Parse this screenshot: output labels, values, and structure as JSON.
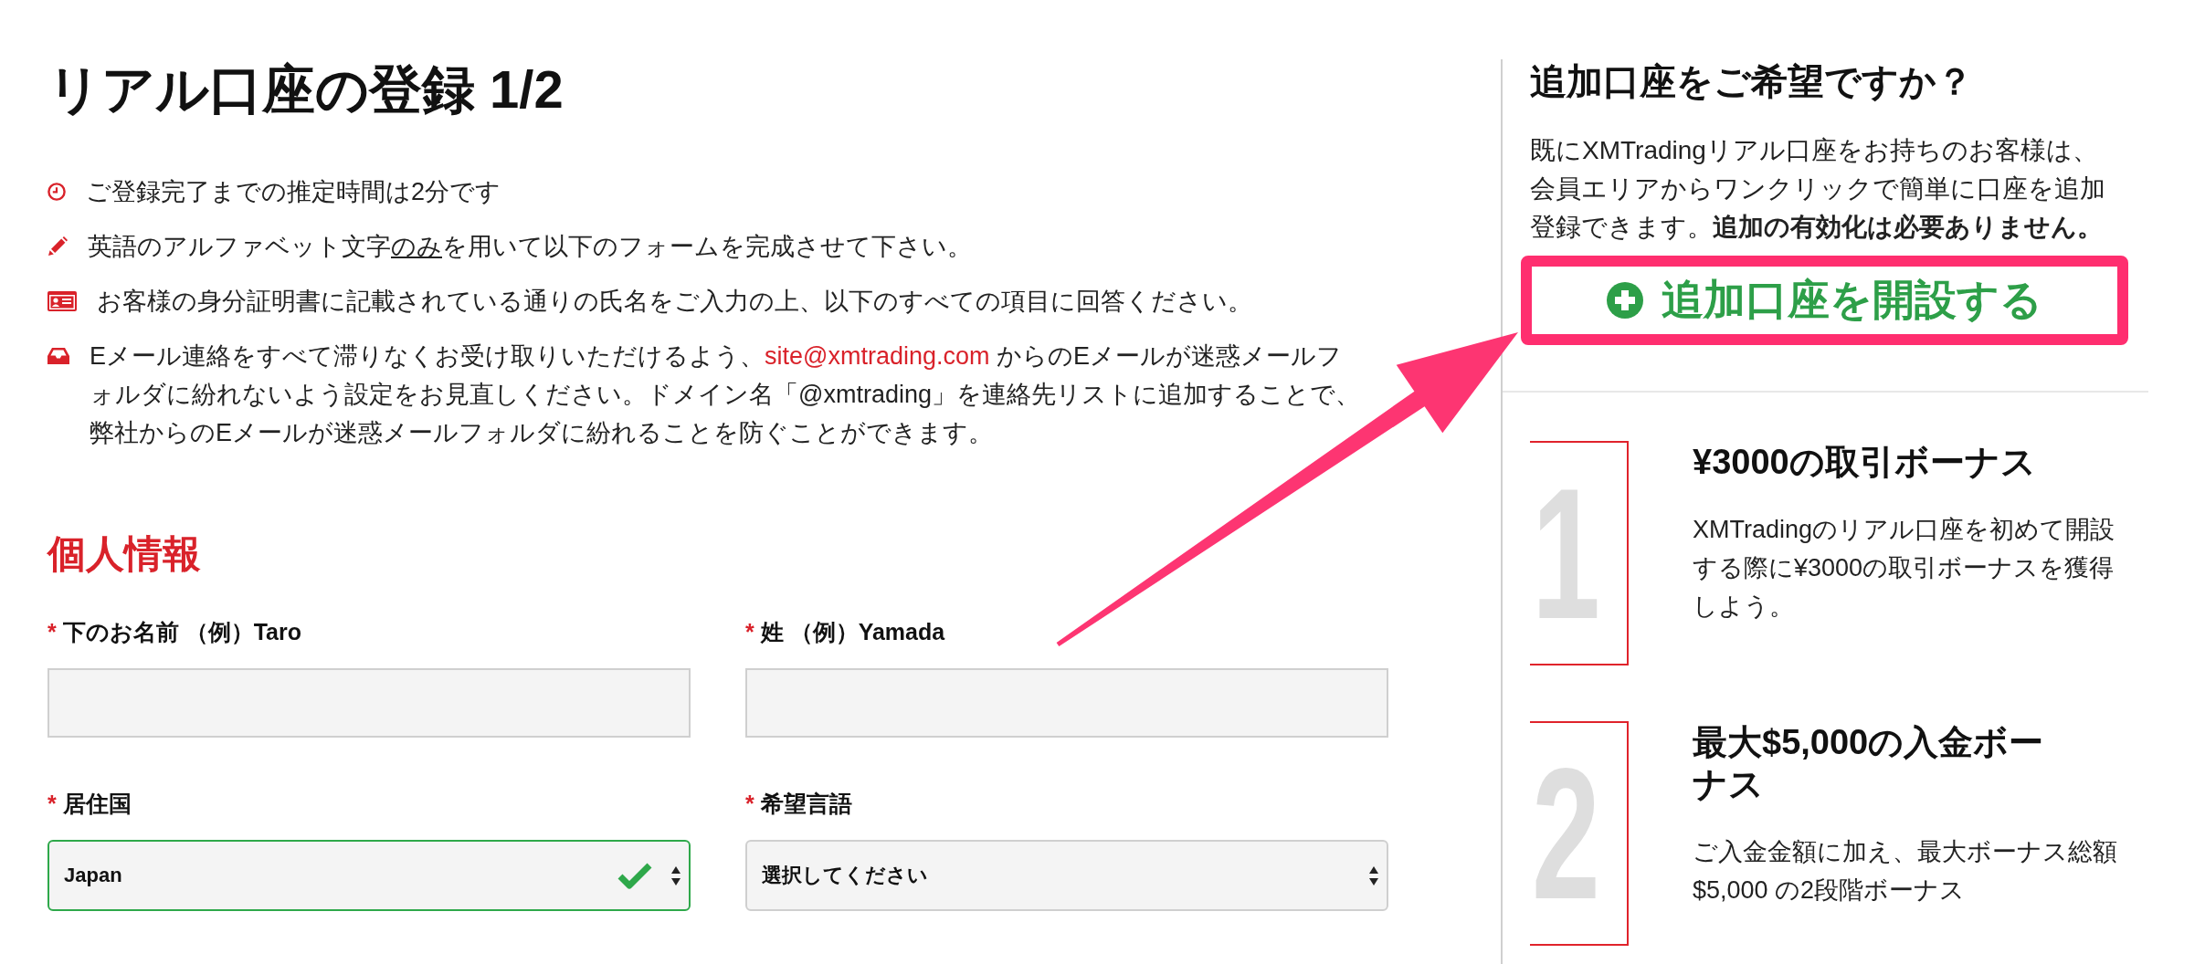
{
  "page_title": "リアル口座の登録 1/2",
  "notices": [
    {
      "kind": "time",
      "segments": [
        {
          "kind": "plain",
          "text": "ご登録完了までの推定時間は2分です"
        }
      ]
    },
    {
      "kind": "language",
      "segments": [
        {
          "kind": "plain",
          "text": "英語のアルファベット文字"
        },
        {
          "kind": "underline",
          "text": "のみ"
        },
        {
          "kind": "plain",
          "text": "を用いて以下のフォームを完成させて下さい。"
        }
      ]
    },
    {
      "kind": "identity",
      "segments": [
        {
          "kind": "plain",
          "text": "お客様の身分証明書に記載されている通りの氏名をご入力の上、以下のすべての項目に回答ください。"
        }
      ]
    },
    {
      "kind": "email",
      "segments": [
        {
          "kind": "plain",
          "text": "Eメール連絡をすべて滞りなくお受け取りいただけるよう、"
        },
        {
          "kind": "link",
          "text": "site@xmtrading.com"
        },
        {
          "kind": "plain",
          "text": " からのEメールが迷惑メールフォルダに紛れないよう設定をお見直しください。ドメイン名「@xmtrading」を連絡先リストに追加することで、弊社からのEメールが迷惑メールフォルダに紛れることを防ぐことができます。"
        }
      ]
    }
  ],
  "section_title": "個人情報",
  "fields": [
    {
      "kind": "text",
      "mark": "*",
      "label": "下のお名前 （例）Taro",
      "valid": false
    },
    {
      "kind": "text",
      "mark": "*",
      "label": "姓 （例）Yamada",
      "valid": false
    },
    {
      "kind": "select",
      "mark": "*",
      "label": "居住国",
      "value": "Japan",
      "valid": true
    },
    {
      "kind": "select",
      "mark": "*",
      "label": "希望言語",
      "value": "選択してください",
      "valid": false
    }
  ],
  "sidebar": {
    "title": "追加口座をご希望ですか？",
    "text": "既にXMTradingリアル口座をお持ちのお客様は、会員エリアからワンクリックで簡単に口座を追加登録できます。**追加の有効化は必要ありません。**",
    "button": "追加口座を開設する"
  },
  "bonuses": [
    {
      "number": "1",
      "title": "¥3000の取引ボーナス",
      "text": "XMTradingのリアル口座を初めて開設する際に¥3000の取引ボーナスを獲得しよう。"
    },
    {
      "number": "2",
      "title": "最大$5,000の入金ボーナス",
      "text": "ご入金金額に加え、最大ボーナス総額$5,000 の2段階ボーナス"
    }
  ],
  "annotation": {
    "highlight_frame": true,
    "arrow": true
  }
}
